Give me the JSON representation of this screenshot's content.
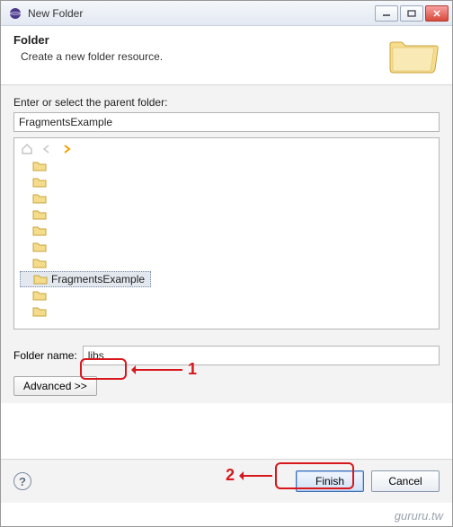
{
  "window": {
    "title": "New Folder"
  },
  "header": {
    "title": "Folder",
    "subtitle": "Create a new folder resource."
  },
  "parent": {
    "label": "Enter or select the parent folder:",
    "value": "FragmentsExample"
  },
  "tree": {
    "selected_label": "FragmentsExample"
  },
  "folder_name": {
    "label": "Folder name:",
    "value": "libs"
  },
  "advanced": {
    "label": "Advanced >>"
  },
  "buttons": {
    "finish": "Finish",
    "cancel": "Cancel"
  },
  "annotations": {
    "one": "1",
    "two": "2"
  },
  "watermark": "gururu.tw"
}
